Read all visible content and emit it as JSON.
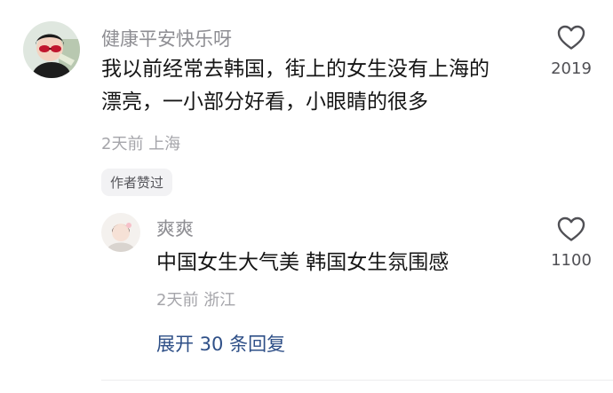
{
  "comments": [
    {
      "username": "健康平安快乐呀",
      "text_line1": "我以前经常去韩国，街上的女生没有上海的",
      "text_line2": "漂亮，一小部分好看，小眼睛的很多",
      "time": "2天前",
      "location": "上海",
      "likes": "2019",
      "badge": "作者赞过"
    }
  ],
  "replies": [
    {
      "username": "爽爽",
      "text": "中国女生大气美 韩国女生氛围感",
      "time": "2天前",
      "location": "浙江",
      "likes": "1100"
    }
  ],
  "expand_label": "展开 30 条回复",
  "icons": {
    "like": "heart-outline-icon"
  },
  "colors": {
    "link": "#2e4f87",
    "muted": "#a5a5aa",
    "text": "#161616"
  }
}
